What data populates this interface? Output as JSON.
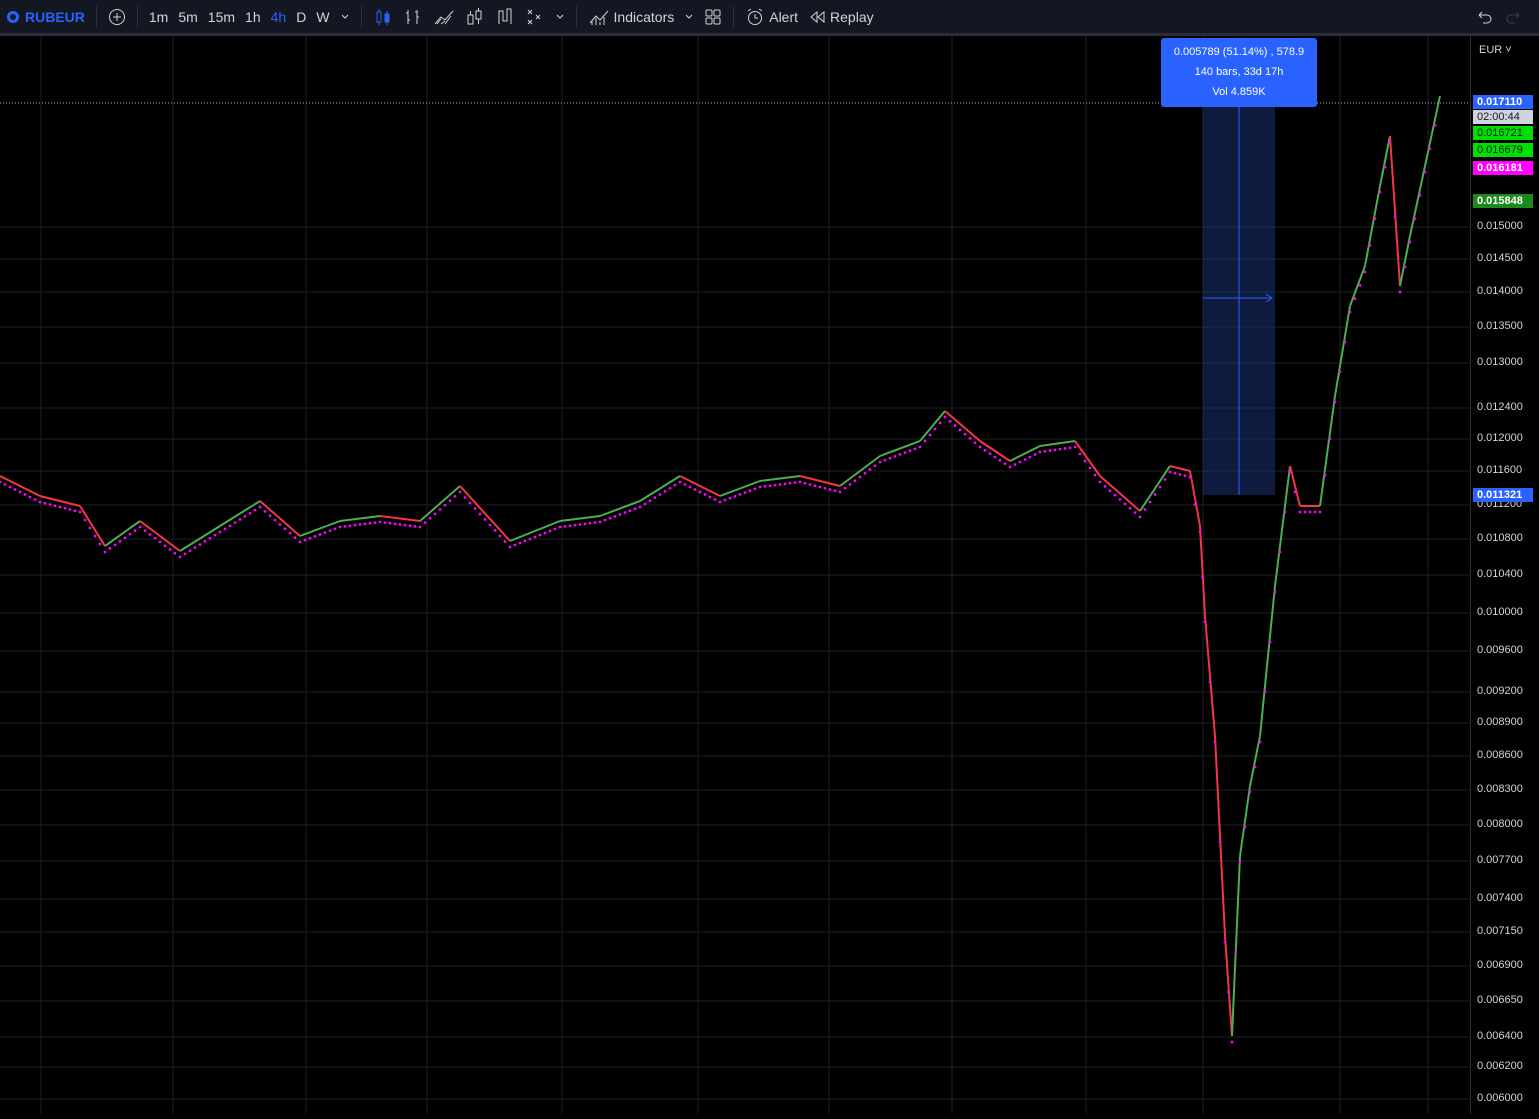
{
  "toolbar": {
    "symbol": "RUBEUR",
    "timeframes": [
      "1m",
      "5m",
      "15m",
      "1h",
      "4h",
      "D",
      "W"
    ],
    "active_timeframe": "4h",
    "indicators_label": "Indicators",
    "alert_label": "Alert",
    "replay_label": "Replay"
  },
  "axis": {
    "currency": "EUR",
    "ticks": [
      "0.015000",
      "0.014500",
      "0.014000",
      "0.013500",
      "0.013000",
      "0.012400",
      "0.012000",
      "0.011600",
      "0.011200",
      "0.010800",
      "0.010400",
      "0.010000",
      "0.009600",
      "0.009200",
      "0.008900",
      "0.008600",
      "0.008300",
      "0.008000",
      "0.007700",
      "0.007400",
      "0.007150",
      "0.006900",
      "0.006650",
      "0.006400",
      "0.006200",
      "0.006000"
    ],
    "last_price": "0.017110",
    "countdown": "02:00:44",
    "tag_green1": "0.016721",
    "tag_green2": "0.016679",
    "tag_magenta": "0.016181",
    "tag_darkgreen": "0.015848",
    "measure_low": "0.011321"
  },
  "measure": {
    "line1": "0.005789 (51.14%) , 578.9",
    "line2": "140 bars, 33d 17h",
    "line3": "Vol 4.859K"
  },
  "colors": {
    "accent": "#2962ff",
    "up": "#4caf50",
    "down": "#f23645",
    "dots": "#ff00ff"
  }
}
